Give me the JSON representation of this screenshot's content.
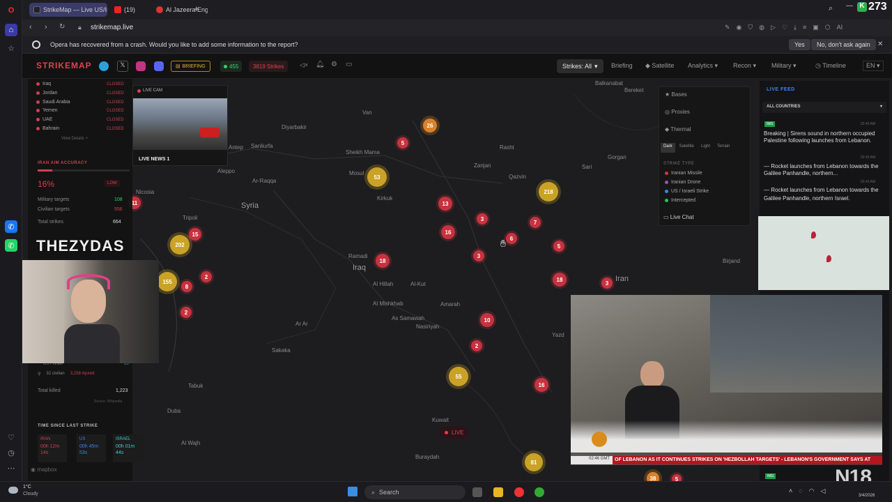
{
  "browser": {
    "tabs": [
      {
        "label": "StrikeMap — Live US/Israe",
        "active": true
      },
      {
        "label": "(19)",
        "active": false
      },
      {
        "label": "Al Jazeera Eng",
        "active": false
      }
    ],
    "address": "strikemap.live",
    "infobar": {
      "message": "Opera has recovered from a crash. Would you like to add some information to the report?",
      "yes_label": "Yes",
      "no_label": "No, don't ask again"
    },
    "counter_overlay": "273"
  },
  "header": {
    "logo": "STRIKEMAP",
    "briefing_badge": "BRIEFING",
    "online_count": "455",
    "strikes_count": "3819 Strikes",
    "nav": {
      "strikes": "Strikes: All",
      "briefing": "Briefing",
      "satellite": "Satellite",
      "analytics": "Analytics",
      "recon": "Recon",
      "military": "Military",
      "timeline": "Timeline",
      "lang": "EN"
    }
  },
  "left_panel": {
    "airspace": [
      {
        "name": "Iraq",
        "status": "CLOSED"
      },
      {
        "name": "Jordan",
        "status": "CLOSED"
      },
      {
        "name": "Saudi Arabia",
        "status": "CLOSED"
      },
      {
        "name": "Yemen",
        "status": "CLOSED"
      },
      {
        "name": "UAE",
        "status": "CLOSED"
      },
      {
        "name": "Bahrain",
        "status": "CLOSED"
      }
    ],
    "view_details": "View Details",
    "accuracy": {
      "title": "IRAN AIM ACCURACY",
      "value": "16%",
      "badge": "LOW",
      "fill": 0.16,
      "military_label": "Military targets",
      "military": "108",
      "civilian_label": "Civilian targets",
      "civilian": "556",
      "total_label": "Total strikes",
      "total": "664"
    },
    "casualties": {
      "us_israel": "US / Israel",
      "us_israel_val": "13",
      "civilian": "32 civilian",
      "injured": "3,238 injured",
      "total_killed_label": "Total killed",
      "total_killed": "1,223",
      "source": "Source: Wikipedia"
    },
    "since_last": {
      "title": "TIME SINCE LAST STRIKE",
      "iran_label": "IRAN",
      "iran_time": "00h 12m 14s",
      "us_label": "US",
      "us_time": "00h 45m 53s",
      "israel_label": "ISRAEL",
      "israel_time": "00h 01m 44s"
    },
    "mapbox": "mapbox"
  },
  "live_cam": {
    "label": "LIVE CAM",
    "caption": "LIVE NEWS 1"
  },
  "layers": {
    "bases": "Bases",
    "proxies": "Proxies",
    "thermal": "Thermal",
    "styles": [
      "Dark",
      "Satellite",
      "Light",
      "Terrain"
    ],
    "strike_type_title": "STRIKE TYPE",
    "legend": [
      {
        "label": "Iranian Missile",
        "color": "#d0344a"
      },
      {
        "label": "Iranian Drone",
        "color": "#a24cc0"
      },
      {
        "label": "US / Israeli Strike",
        "color": "#3b82f6"
      },
      {
        "label": "Intercepted",
        "color": "#22c55e"
      }
    ],
    "live_chat": "Live Chat"
  },
  "feed": {
    "title": "LIVE FEED",
    "filter": "ALL COUNTRIES",
    "items": [
      {
        "tag": "IMG",
        "time": "02:43 AM",
        "text": "Breaking | Sirens sound in northern occupied Palestine following launches from Lebanon."
      },
      {
        "tag": "",
        "time": "02:43 AM",
        "text": "— Rocket launches from Lebanon towards the Galilee Panhandle, northern..."
      },
      {
        "tag": "",
        "time": "02:43 AM",
        "text": "— Rocket launches from Lebanon towards the Galilee Panhandle, northern Israel."
      }
    ],
    "bottom_tag": "IMG"
  },
  "map": {
    "labels": [
      {
        "text": "Van"
      },
      {
        "text": "Diyarbakir"
      },
      {
        "text": "Sanliurfa"
      },
      {
        "text": "Aleppo"
      },
      {
        "text": "Antep"
      },
      {
        "text": "Ar-Raqqa"
      },
      {
        "text": "Sheikh Mama"
      },
      {
        "text": "Mosul"
      },
      {
        "text": "Kirkuk"
      },
      {
        "text": "Zanjan"
      },
      {
        "text": "Qazvin"
      },
      {
        "text": "Rasht"
      },
      {
        "text": "Sari"
      },
      {
        "text": "Gorgan"
      },
      {
        "text": "Balkanabat"
      },
      {
        "text": "Bereket"
      },
      {
        "text": "Nicosia"
      },
      {
        "text": "Tripoli"
      },
      {
        "text": "Ramadi"
      },
      {
        "text": "Al Hillah"
      },
      {
        "text": "Al-Kut"
      },
      {
        "text": "Al Mishkhab"
      },
      {
        "text": "Amarah"
      },
      {
        "text": "As Samawah"
      },
      {
        "text": "Nasiriyah"
      },
      {
        "text": "Ar Ar"
      },
      {
        "text": "Sakaka"
      },
      {
        "text": "Tabuk"
      },
      {
        "text": "Duba"
      },
      {
        "text": "Al Wajh"
      },
      {
        "text": "Buraydah"
      },
      {
        "text": "Birjand"
      },
      {
        "text": "Yazd"
      },
      {
        "text": "Kuwait"
      }
    ],
    "countries": [
      "Syria",
      "Iraq",
      "Iran"
    ],
    "markers": [
      {
        "n": "26",
        "c": "orange"
      },
      {
        "n": "5",
        "c": "red"
      },
      {
        "n": "53",
        "c": "gold"
      },
      {
        "n": "218",
        "c": "gold"
      },
      {
        "n": "11",
        "c": "red"
      },
      {
        "n": "13",
        "c": "red"
      },
      {
        "n": "16",
        "c": "red"
      },
      {
        "n": "3",
        "c": "red"
      },
      {
        "n": "7",
        "c": "red"
      },
      {
        "n": "6",
        "c": "red"
      },
      {
        "n": "5",
        "c": "red"
      },
      {
        "n": "3",
        "c": "red"
      },
      {
        "n": "15",
        "c": "red"
      },
      {
        "n": "202",
        "c": "gold"
      },
      {
        "n": "18",
        "c": "red"
      },
      {
        "n": "18",
        "c": "red"
      },
      {
        "n": "3",
        "c": "red"
      },
      {
        "n": "155",
        "c": "gold"
      },
      {
        "n": "8",
        "c": "red"
      },
      {
        "n": "2",
        "c": "red"
      },
      {
        "n": "2",
        "c": "red"
      },
      {
        "n": "10",
        "c": "red"
      },
      {
        "n": "2",
        "c": "red"
      },
      {
        "n": "55",
        "c": "gold"
      },
      {
        "n": "16",
        "c": "red"
      },
      {
        "n": "81",
        "c": "gold"
      },
      {
        "n": "38",
        "c": "orange"
      },
      {
        "n": "5",
        "c": "red"
      }
    ],
    "live_label": "LIVE"
  },
  "webcam": {
    "title": "THEZYDAS"
  },
  "news": {
    "ticker": "OF LEBANON AS IT CONTINUES STRIKES ON 'HEZBOLLAH TARGETS' - LEBANON'S GOVERNMENT SAYS AT",
    "clock": "02:46 GMT"
  },
  "watermark": "N18",
  "taskbar": {
    "temp": "1°C",
    "weather": "Cloudy",
    "search": "Search",
    "time": "",
    "date": "3/4/2026"
  }
}
